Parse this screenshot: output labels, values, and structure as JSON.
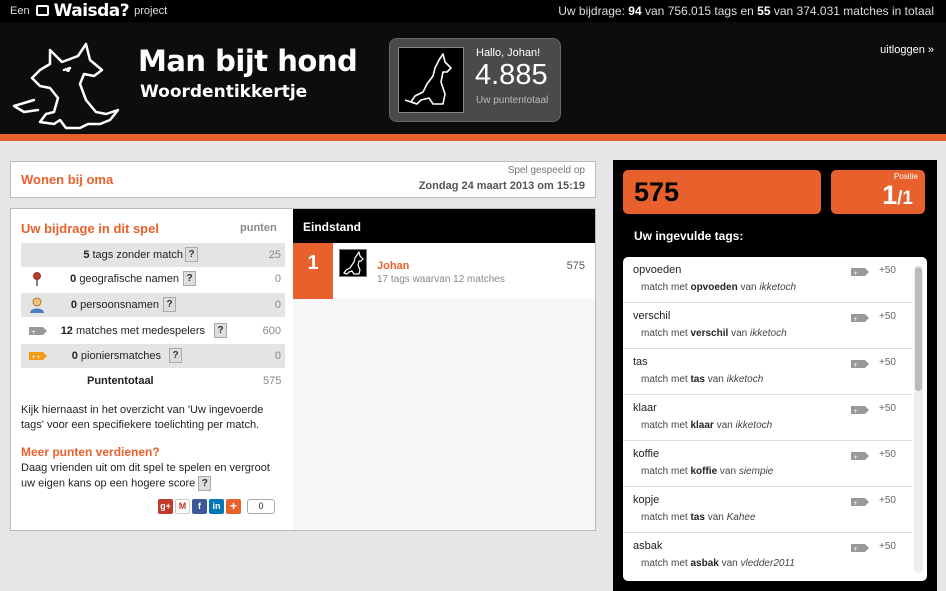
{
  "topbar": {
    "prefix": "Een",
    "brand": "Waisda?",
    "suffix": "project",
    "stats": {
      "label": "Uw bijdrage:",
      "my_tags": "94",
      "of1": "van",
      "total_tags": "756.015",
      "tags_and": "tags en",
      "my_matches": "55",
      "of2": "van",
      "total_matches": "374.031",
      "tail": "matches in totaal"
    }
  },
  "header": {
    "title": "Man bijt hond",
    "subtitle": "Woordentikkertje",
    "greeting": "Hallo, Johan!",
    "score": "4.885",
    "score_label": "Uw puntentotaal",
    "logout": "uitloggen »"
  },
  "game": {
    "name": "Wonen bij oma",
    "played_label": "Spel gespeeld op",
    "date": "Zondag 24 maart 2013 om 15:19"
  },
  "contribution": {
    "heading": "Uw bijdrage in dit spel",
    "points_heading": "punten",
    "rows": [
      {
        "count": "5",
        "label": "tags zonder match",
        "help": "?",
        "points": "25"
      },
      {
        "count": "0",
        "label": "geografische namen",
        "help": "?",
        "points": "0"
      },
      {
        "count": "0",
        "label": "persoonsnamen",
        "help": "?",
        "points": "0"
      },
      {
        "count": "12",
        "label": "matches met medespelers",
        "help": "?",
        "points": "600"
      },
      {
        "count": "0",
        "label": "pioniersmatches",
        "help": "?",
        "points": "0"
      }
    ],
    "total_label": "Puntentotaal",
    "total_value": "575",
    "explanation": "Kijk hiernaast in het overzicht van 'Uw ingevoerde tags' voor een specifiekere toelichting per match.",
    "more_heading": "Meer punten verdienen?",
    "more_text": "Daag vrienden uit om dit spel te spelen en vergroot uw eigen kans op een hogere score",
    "more_help": "?",
    "share_count": "0"
  },
  "ranking": {
    "heading": "Eindstand",
    "entries": [
      {
        "rank": "1",
        "name": "Johan",
        "detail": "17 tags waarvan 12 matches",
        "score": "575"
      }
    ]
  },
  "sidepanel": {
    "score": "575",
    "position_label": "Positie",
    "position": "1",
    "position_total": "/1",
    "tags_heading": "Uw ingevulde tags:",
    "tags": [
      {
        "tag": "opvoeden",
        "points": "+50",
        "match_prefix": "match met",
        "match_word": "opvoeden",
        "of": "van",
        "player": "ikketoch"
      },
      {
        "tag": "verschil",
        "points": "+50",
        "match_prefix": "match met",
        "match_word": "verschil",
        "of": "van",
        "player": "ikketoch"
      },
      {
        "tag": "tas",
        "points": "+50",
        "match_prefix": "match met",
        "match_word": "tas",
        "of": "van",
        "player": "ikketoch"
      },
      {
        "tag": "klaar",
        "points": "+50",
        "match_prefix": "match met",
        "match_word": "klaar",
        "of": "van",
        "player": "ikketoch"
      },
      {
        "tag": "koffie",
        "points": "+50",
        "match_prefix": "match met",
        "match_word": "koffie",
        "of": "van",
        "player": "siempie"
      },
      {
        "tag": "kopje",
        "points": "+50",
        "match_prefix": "match met",
        "match_word": "tas",
        "of": "van",
        "player": "Kahee"
      },
      {
        "tag": "asbak",
        "points": "+50",
        "match_prefix": "match met",
        "match_word": "asbak",
        "of": "van",
        "player": "vledder2011"
      }
    ]
  },
  "colors": {
    "accent": "#e8612c",
    "header_bg": "#0d0d0d"
  }
}
